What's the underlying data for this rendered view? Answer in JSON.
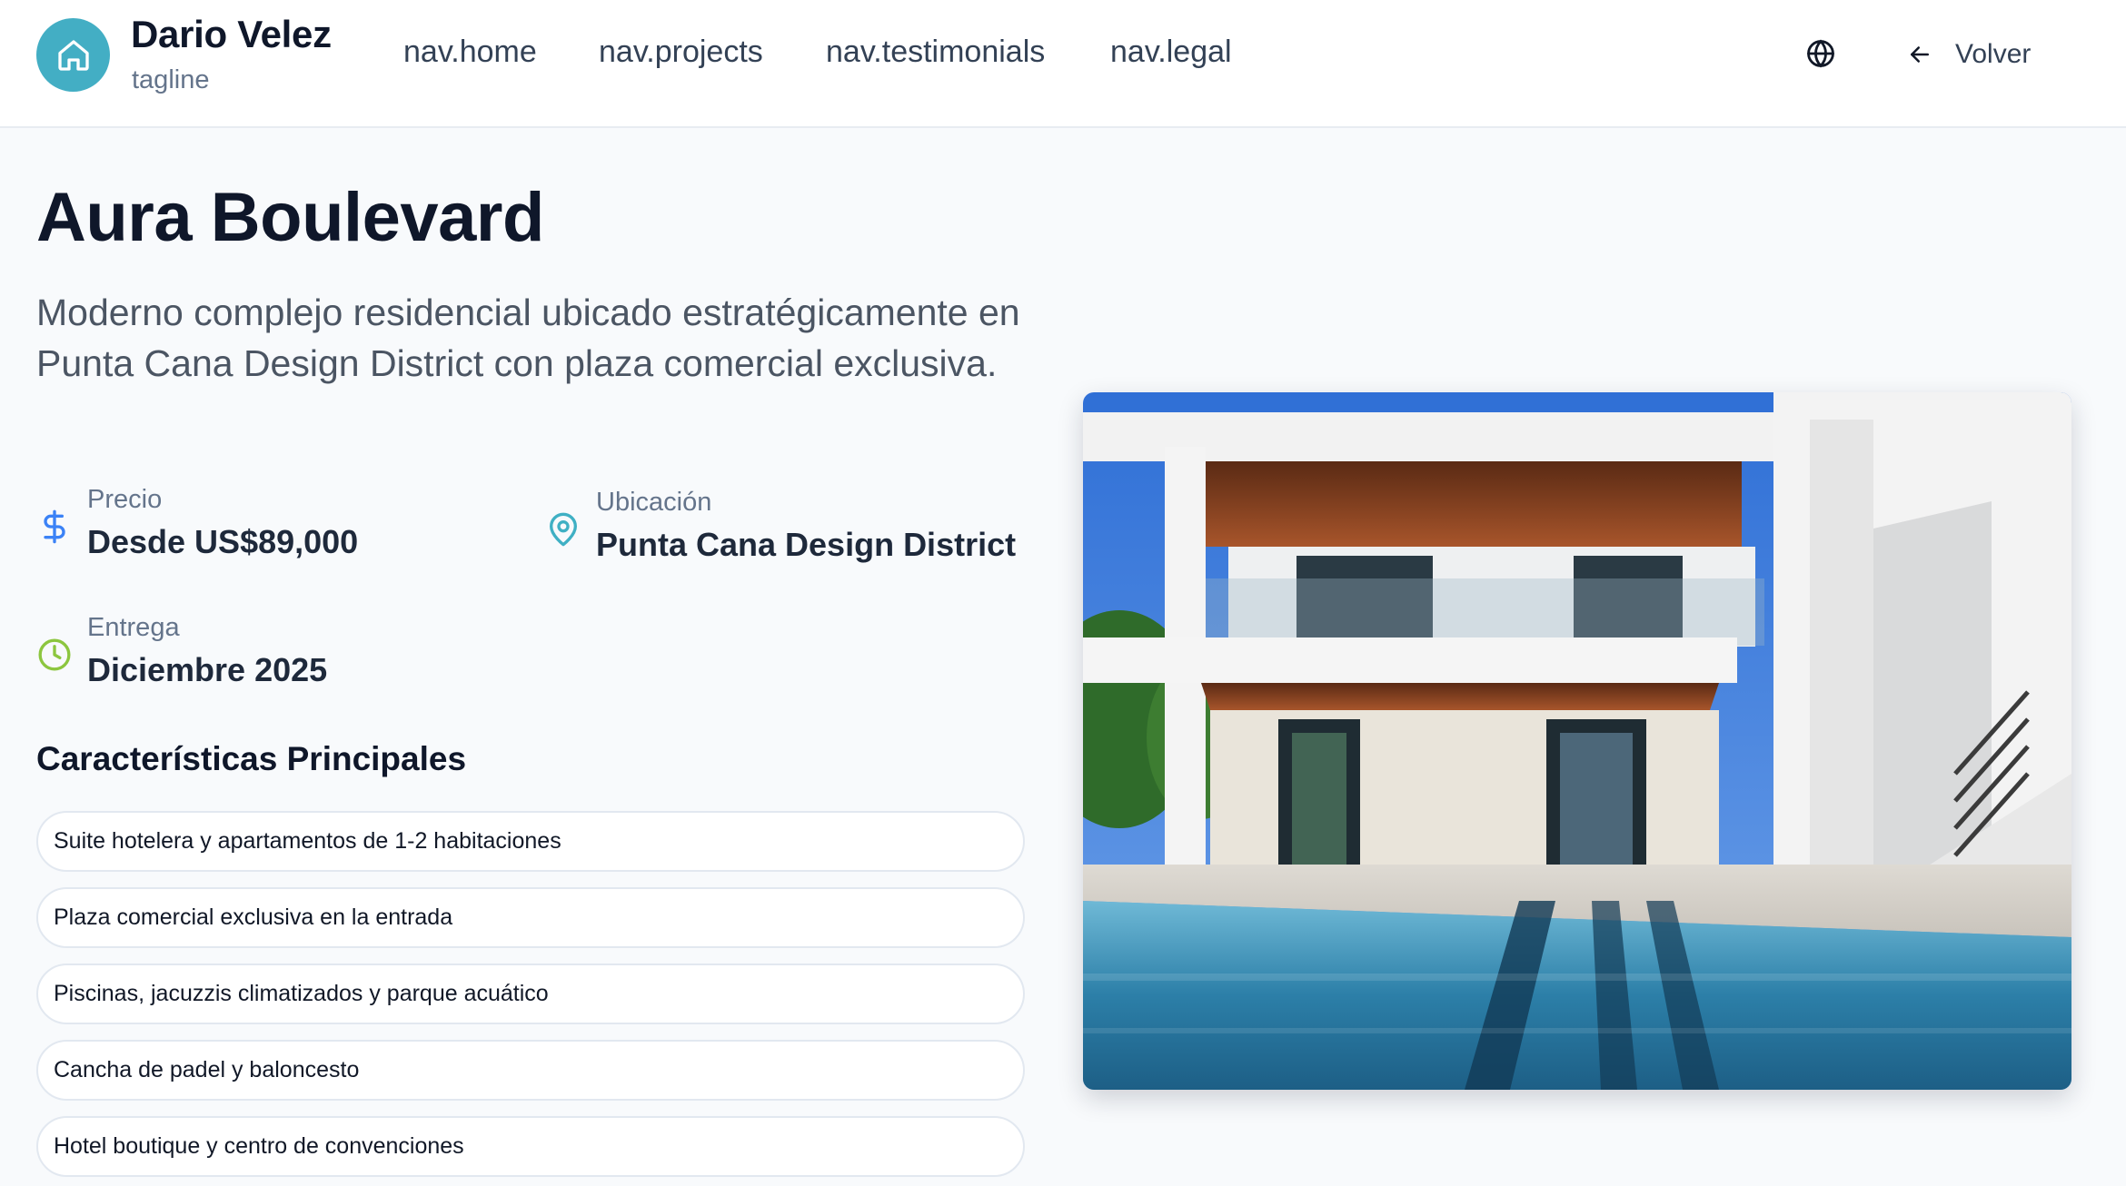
{
  "header": {
    "brand_name": "Dario Velez",
    "tagline": "tagline",
    "logo_icon": "home-icon",
    "nav": [
      {
        "label": "nav.home"
      },
      {
        "label": "nav.projects"
      },
      {
        "label": "nav.testimonials"
      },
      {
        "label": "nav.legal"
      }
    ],
    "language_icon": "globe-icon",
    "back_label": "Volver"
  },
  "project": {
    "title": "Aura Boulevard",
    "description": "Moderno complejo residencial ubicado estratégicamente en Punta Cana Design District con plaza comercial exclusiva.",
    "price": {
      "label": "Precio",
      "value": "Desde US$89,000",
      "icon": "dollar-icon"
    },
    "location": {
      "label": "Ubicación",
      "value": "Punta Cana Design District",
      "icon": "map-pin-icon"
    },
    "delivery": {
      "label": "Entrega",
      "value": "Diciembre 2025",
      "icon": "clock-icon"
    },
    "features_title": "Características Principales",
    "features": [
      "Suite hotelera y apartamentos de 1-2 habitaciones",
      "Plaza comercial exclusiva en la entrada",
      "Piscinas, jacuzzis climatizados y parque acuático",
      "Cancha de padel y baloncesto",
      "Hotel boutique y centro de convenciones"
    ]
  },
  "colors": {
    "brand": "#43aec4",
    "price_icon": "#3b82f6",
    "location_icon": "#3fb0c4",
    "delivery_icon": "#8cc63f"
  }
}
